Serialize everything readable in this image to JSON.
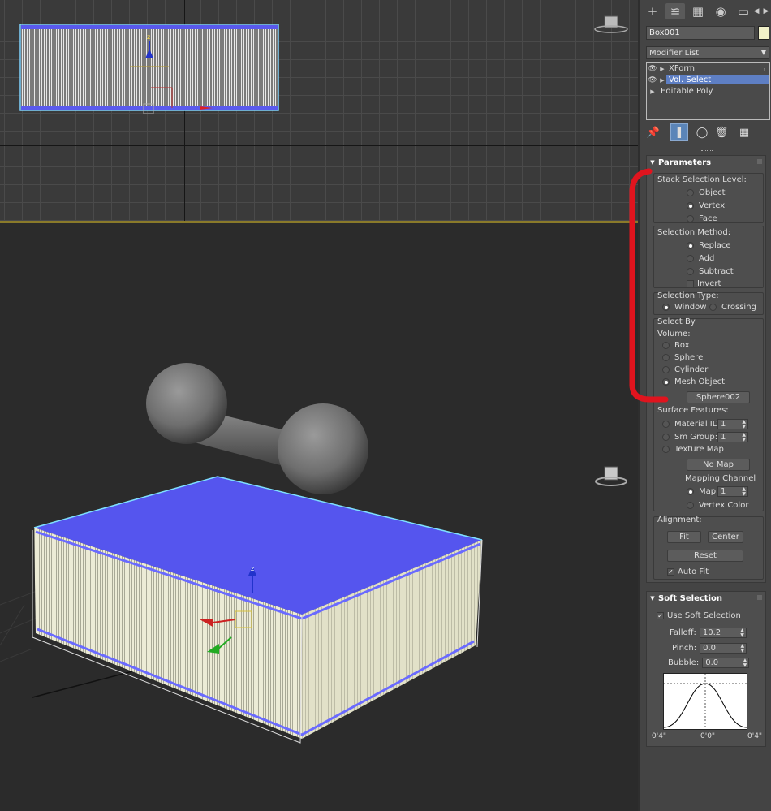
{
  "top_viewport": {},
  "persp_viewport": {
    "gizmo_axis_label": "z",
    "top_gizmo_axis_label": "z"
  },
  "panel": {
    "tabs": [
      "create-icon",
      "modify-icon",
      "hierarchy-icon",
      "motion-icon",
      "display-icon"
    ],
    "object_name": "Box001",
    "object_color": "#f0f0c8",
    "modifier_list_label": "Modifier List",
    "stack": [
      {
        "label": "XForm",
        "visible": true,
        "selected": false
      },
      {
        "label": "Vol. Select",
        "visible": true,
        "selected": true
      },
      {
        "label": "Editable Poly",
        "visible": false,
        "selected": false
      }
    ],
    "tools": [
      "pin-stack-icon",
      "show-end-result-icon",
      "make-unique-icon",
      "remove-modifier-icon",
      "configure-sets-icon"
    ]
  },
  "parameters": {
    "title": "Parameters",
    "stack_selection_level": {
      "label": "Stack Selection Level:",
      "options": [
        "Object",
        "Vertex",
        "Face"
      ],
      "selected": "Vertex"
    },
    "selection_method": {
      "label": "Selection Method:",
      "options": [
        "Replace",
        "Add",
        "Subtract"
      ],
      "selected": "Replace",
      "invert_label": "Invert"
    },
    "selection_type": {
      "label": "Selection Type:",
      "options": [
        "Window",
        "Crossing"
      ],
      "selected": "Window"
    },
    "select_by": {
      "label": "Select By",
      "volume_label": "Volume:",
      "options": [
        "Box",
        "Sphere",
        "Cylinder",
        "Mesh Object"
      ],
      "selected": "Mesh Object",
      "mesh_button": "Sphere002"
    },
    "surface_features": {
      "label": "Surface Features:",
      "material_id_label": "Material ID:",
      "material_id_value": "1",
      "sm_group_label": "Sm Group:",
      "sm_group_value": "1",
      "texture_map_label": "Texture Map",
      "no_map_button": "No Map",
      "mapping_channel_label": "Mapping Channel",
      "map_label": "Map",
      "map_value": "1",
      "vertex_color_label": "Vertex Color"
    },
    "alignment": {
      "label": "Alignment:",
      "fit": "Fit",
      "center": "Center",
      "reset": "Reset",
      "auto_fit_label": "Auto Fit",
      "auto_fit_checked": true
    }
  },
  "soft_selection": {
    "title": "Soft Selection",
    "use_soft_selection_label": "Use Soft Selection",
    "use_soft_selection_checked": true,
    "falloff_label": "Falloff:",
    "falloff_value": "10.2",
    "pinch_label": "Pinch:",
    "pinch_value": "0.0",
    "bubble_label": "Bubble:",
    "bubble_value": "0.0",
    "curve_left": "0'4\"",
    "curve_center": "0'0\"",
    "curve_right": "0'4\""
  },
  "annotation": {
    "color": "#e0141e"
  }
}
